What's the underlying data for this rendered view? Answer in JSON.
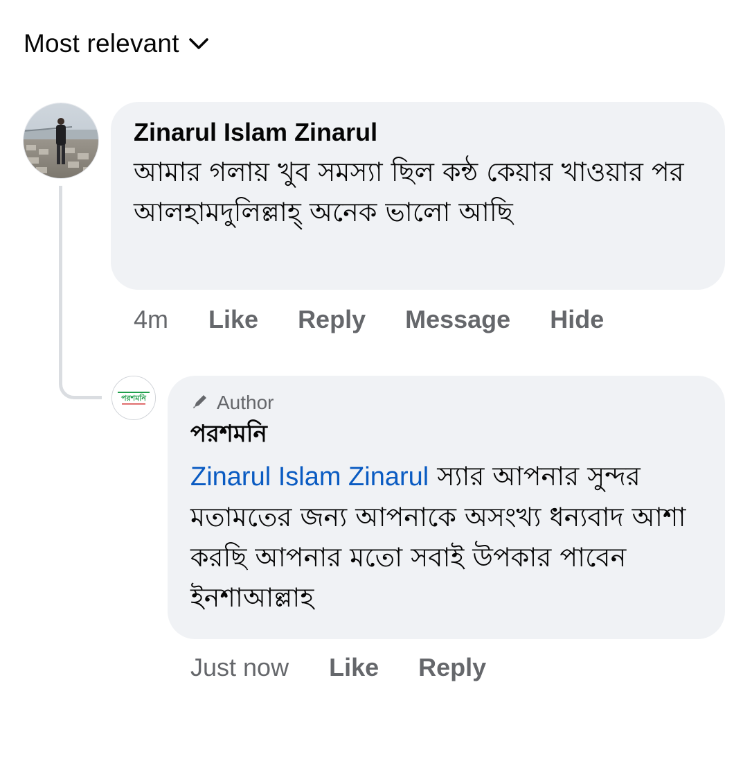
{
  "sort": {
    "label": "Most relevant"
  },
  "comment": {
    "author": "Zinarul Islam Zinarul",
    "text": "আমার গলায় খুব সমস্যা ছিল কন্ঠ কেয়ার খাওয়ার পর আলহামদুলিল্লাহ্ অনেক ভালো আছি",
    "time": "4m",
    "actions": {
      "like": "Like",
      "reply": "Reply",
      "message": "Message",
      "hide": "Hide"
    }
  },
  "reply": {
    "badge": "Author",
    "page_name": "পরশমনি",
    "mention": "Zinarul Islam Zinarul",
    "text": "স্যার আপনার সুন্দর মতামতের জন্য আপনাকে অসংখ্য ধন্যবাদ আশা করছি আপনার মতো সবাই উপকার পাবেন ইনশাআল্লাহ",
    "time": "Just now",
    "actions": {
      "like": "Like",
      "reply": "Reply"
    },
    "avatar_text": "পরশমনি"
  },
  "colors": {
    "bubble": "#f0f2f5",
    "secondary_text": "#65676b",
    "mention": "#0a5bc2",
    "thread_line": "#dadde1",
    "brand_green": "#1e9e4a",
    "brand_red": "#d22a2a"
  }
}
